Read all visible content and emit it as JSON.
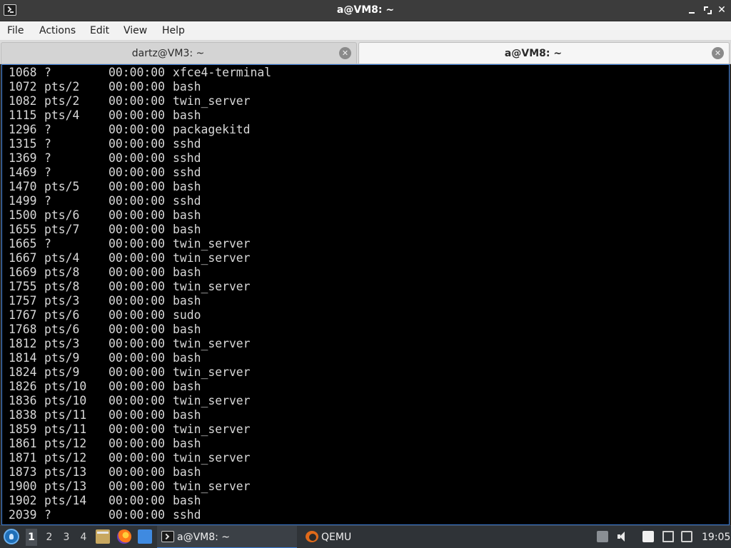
{
  "window": {
    "title": "a@VM8: ~"
  },
  "menu": [
    "File",
    "Actions",
    "Edit",
    "View",
    "Help"
  ],
  "tabs": [
    {
      "label": "dartz@VM3: ~",
      "active": false
    },
    {
      "label": "a@VM8: ~",
      "active": true
    }
  ],
  "terminal": {
    "rows": [
      {
        "pid": "1068",
        "tty": "?",
        "time": "00:00:00",
        "cmd": "xfce4-terminal"
      },
      {
        "pid": "1072",
        "tty": "pts/2",
        "time": "00:00:00",
        "cmd": "bash"
      },
      {
        "pid": "1082",
        "tty": "pts/2",
        "time": "00:00:00",
        "cmd": "twin_server"
      },
      {
        "pid": "1115",
        "tty": "pts/4",
        "time": "00:00:00",
        "cmd": "bash"
      },
      {
        "pid": "1296",
        "tty": "?",
        "time": "00:00:00",
        "cmd": "packagekitd"
      },
      {
        "pid": "1315",
        "tty": "?",
        "time": "00:00:00",
        "cmd": "sshd"
      },
      {
        "pid": "1369",
        "tty": "?",
        "time": "00:00:00",
        "cmd": "sshd"
      },
      {
        "pid": "1469",
        "tty": "?",
        "time": "00:00:00",
        "cmd": "sshd"
      },
      {
        "pid": "1470",
        "tty": "pts/5",
        "time": "00:00:00",
        "cmd": "bash"
      },
      {
        "pid": "1499",
        "tty": "?",
        "time": "00:00:00",
        "cmd": "sshd"
      },
      {
        "pid": "1500",
        "tty": "pts/6",
        "time": "00:00:00",
        "cmd": "bash"
      },
      {
        "pid": "1655",
        "tty": "pts/7",
        "time": "00:00:00",
        "cmd": "bash"
      },
      {
        "pid": "1665",
        "tty": "?",
        "time": "00:00:00",
        "cmd": "twin_server"
      },
      {
        "pid": "1667",
        "tty": "pts/4",
        "time": "00:00:00",
        "cmd": "twin_server"
      },
      {
        "pid": "1669",
        "tty": "pts/8",
        "time": "00:00:00",
        "cmd": "bash"
      },
      {
        "pid": "1755",
        "tty": "pts/8",
        "time": "00:00:00",
        "cmd": "twin_server"
      },
      {
        "pid": "1757",
        "tty": "pts/3",
        "time": "00:00:00",
        "cmd": "bash"
      },
      {
        "pid": "1767",
        "tty": "pts/6",
        "time": "00:00:00",
        "cmd": "sudo"
      },
      {
        "pid": "1768",
        "tty": "pts/6",
        "time": "00:00:00",
        "cmd": "bash"
      },
      {
        "pid": "1812",
        "tty": "pts/3",
        "time": "00:00:00",
        "cmd": "twin_server"
      },
      {
        "pid": "1814",
        "tty": "pts/9",
        "time": "00:00:00",
        "cmd": "bash"
      },
      {
        "pid": "1824",
        "tty": "pts/9",
        "time": "00:00:00",
        "cmd": "twin_server"
      },
      {
        "pid": "1826",
        "tty": "pts/10",
        "time": "00:00:00",
        "cmd": "bash"
      },
      {
        "pid": "1836",
        "tty": "pts/10",
        "time": "00:00:00",
        "cmd": "twin_server"
      },
      {
        "pid": "1838",
        "tty": "pts/11",
        "time": "00:00:00",
        "cmd": "bash"
      },
      {
        "pid": "1859",
        "tty": "pts/11",
        "time": "00:00:00",
        "cmd": "twin_server"
      },
      {
        "pid": "1861",
        "tty": "pts/12",
        "time": "00:00:00",
        "cmd": "bash"
      },
      {
        "pid": "1871",
        "tty": "pts/12",
        "time": "00:00:00",
        "cmd": "twin_server"
      },
      {
        "pid": "1873",
        "tty": "pts/13",
        "time": "00:00:00",
        "cmd": "bash"
      },
      {
        "pid": "1900",
        "tty": "pts/13",
        "time": "00:00:00",
        "cmd": "twin_server"
      },
      {
        "pid": "1902",
        "tty": "pts/14",
        "time": "00:00:00",
        "cmd": "bash"
      },
      {
        "pid": "2039",
        "tty": "?",
        "time": "00:00:00",
        "cmd": "sshd"
      }
    ]
  },
  "taskbar": {
    "workspaces": [
      "1",
      "2",
      "3",
      "4"
    ],
    "active_workspace": "1",
    "tasks": [
      {
        "label": "a@VM8: ~",
        "icon": "terminal-icon",
        "active": true
      },
      {
        "label": "QEMU",
        "icon": "qemu-icon",
        "active": false
      }
    ],
    "clock": "19:05"
  },
  "colors": {
    "terminal_bg": "#000000",
    "terminal_fg": "#d8d8d8",
    "accent": "#3a7bd5",
    "titlebar": "#3c3c3c"
  }
}
